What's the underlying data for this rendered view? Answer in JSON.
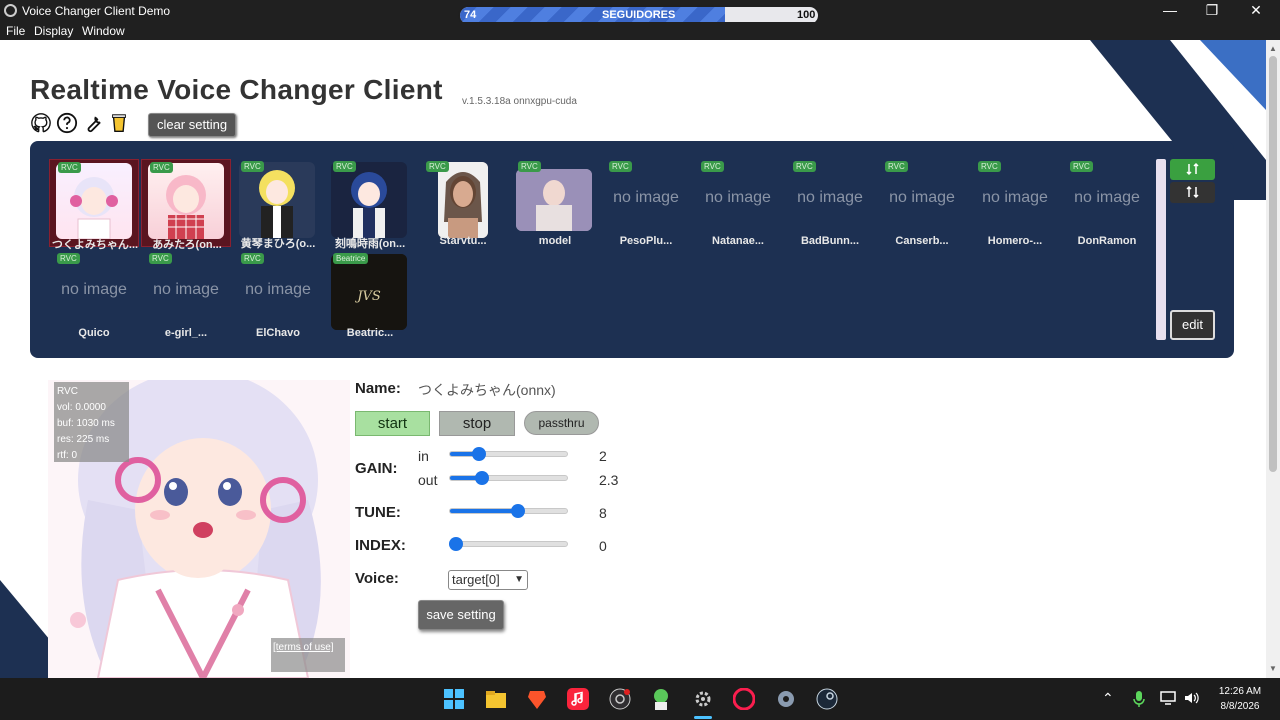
{
  "window": {
    "title": "Voice Changer Client Demo",
    "minimize": "—",
    "maximize": "❐",
    "close": "✕"
  },
  "followers": {
    "label": "SEGUIDORES",
    "current": "74",
    "max": "100",
    "progress": 0.74
  },
  "menu": [
    "File",
    "Display",
    "Window"
  ],
  "header": {
    "title": "Realtime Voice Changer Client",
    "version": "v.1.5.3.18a  onnxgpu-cuda",
    "clear_setting": "clear setting"
  },
  "models": [
    {
      "label": "つくよみちゃん...",
      "badge": "RVC",
      "image": true,
      "selected": true
    },
    {
      "label": "あみたろ(on...",
      "badge": "RVC",
      "image": true,
      "selected": true
    },
    {
      "label": "黄琴まひろ(o...",
      "badge": "RVC",
      "image": true,
      "selected": false
    },
    {
      "label": "刻鳴時雨(on...",
      "badge": "RVC",
      "image": true,
      "selected": false
    },
    {
      "label": "Starvtu...",
      "badge": "RVC",
      "image": true,
      "selected": false
    },
    {
      "label": "model",
      "badge": "RVC",
      "image": true,
      "selected": false
    },
    {
      "label": "PesoPlu...",
      "badge": "RVC",
      "image": false,
      "selected": false
    },
    {
      "label": "Natanae...",
      "badge": "RVC",
      "image": false,
      "selected": false
    },
    {
      "label": "BadBunn...",
      "badge": "RVC",
      "image": false,
      "selected": false
    },
    {
      "label": "Canserb...",
      "badge": "RVC",
      "image": false,
      "selected": false
    },
    {
      "label": "Homero-...",
      "badge": "RVC",
      "image": false,
      "selected": false
    },
    {
      "label": "DonRamon",
      "badge": "RVC",
      "image": false,
      "selected": false
    },
    {
      "label": "Quico",
      "badge": "RVC",
      "image": false,
      "selected": false
    },
    {
      "label": "e-girl_...",
      "badge": "RVC",
      "image": false,
      "selected": false
    },
    {
      "label": "ElChavo",
      "badge": "RVC",
      "image": false,
      "selected": false
    },
    {
      "label": "Beatric...",
      "badge": "Beatrice",
      "image": true,
      "selected": false
    }
  ],
  "no_image": "no image",
  "edit_label": "edit",
  "stats": {
    "badge": "RVC",
    "vol": "vol: 0.0000",
    "buf": "buf: 1030 ms",
    "res": "res: 225 ms",
    "rtf": "rtf: 0"
  },
  "terms": "[terms of use]",
  "controls": {
    "name_label": "Name:",
    "name_value": "つくよみちゃん(onnx)",
    "start": "start",
    "stop": "stop",
    "passthru": "passthru",
    "gain_label": "GAIN:",
    "in_label": "in",
    "out_label": "out",
    "gain_in": {
      "value": "2",
      "fraction": 0.25
    },
    "gain_out": {
      "value": "2.3",
      "fraction": 0.27
    },
    "tune_label": "TUNE:",
    "tune": {
      "value": "8",
      "fraction": 0.58
    },
    "index_label": "INDEX:",
    "index": {
      "value": "0",
      "fraction": 0.05
    },
    "voice_label": "Voice:",
    "voice_value": "target[0]",
    "save_setting": "save setting"
  },
  "taskbar": {
    "time": "12:26 AM",
    "date": "8/8/2026"
  },
  "colors": {
    "panel": "#1d3052",
    "accent_blue": "#1a73e8",
    "start_green": "#a8e0a0",
    "stripe_blue": "#3b6fc4"
  }
}
